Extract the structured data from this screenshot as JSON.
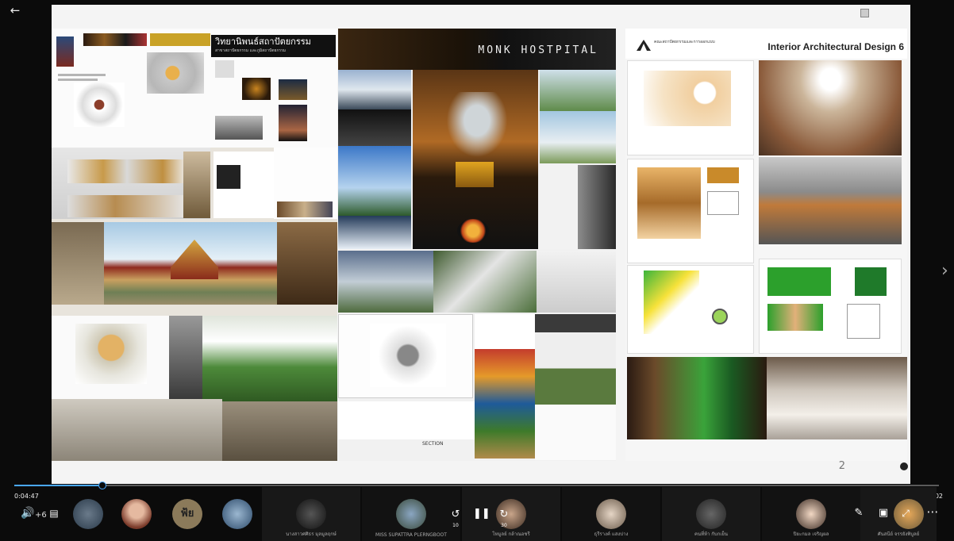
{
  "slide": {
    "left_panel": {
      "title": "วิทยานิพนธ์สถาปัตยกรรม",
      "subtitle": "สาขาสถาปัตยกรรม และภูมิสถาปัตยกรรม"
    },
    "middle_panel": {
      "title": "MONK HOSTPITAL",
      "section_label": "SECTION"
    },
    "right_panel": {
      "org": "คณะสถาปัตยกรรมและการออกแบบ",
      "title": "Interior Architectural Design 6"
    },
    "page_number": "2"
  },
  "player": {
    "current_time": "0:04:47",
    "total_time": "0:50:02",
    "progress": 0.095,
    "extra_participants": "+6",
    "skip_label": "10",
    "skip_forward_label": "30"
  },
  "participants": [
    {
      "name": "นางสาวศศิธร มุลมูลฤกษ์"
    },
    {
      "name": "MISS SUPATTRA PLERNGBOOT"
    },
    {
      "name": "โหมูลย์ กล้าณอชรี"
    },
    {
      "name": "ธุรีรางค์ แสงบ่าง"
    },
    {
      "name": "คนที่ห้า กับกเย็น"
    },
    {
      "name": "ปิยะกมล เจริญผล"
    },
    {
      "name": "ศันสนีย์ จรรยังพิบูลย์"
    }
  ],
  "avatar_initial": "ฟ้ย",
  "colors": {
    "accent": "#4aa8ff",
    "background": "#0b0b0b"
  }
}
